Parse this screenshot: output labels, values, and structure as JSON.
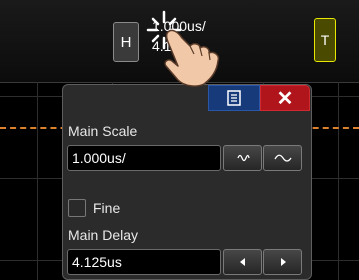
{
  "top": {
    "h_label": "H",
    "t_label": "T",
    "readout_line1": "1.000us/",
    "readout_line2": "4.1"
  },
  "panel": {
    "main_scale_label": "Main Scale",
    "main_scale_value": "1.000us/",
    "fine_label": "Fine",
    "fine_checked": false,
    "main_delay_label": "Main Delay",
    "main_delay_value": "4.125us",
    "close_symbol": "✕",
    "icons": [
      "list-icon",
      "close-icon",
      "fine-wave-icon",
      "coarse-wave-icon",
      "left-arrow-icon",
      "right-arrow-icon",
      "tap-gesture-icon"
    ]
  },
  "colors": {
    "trigger": "#d9822b",
    "list_button": "#173a7a",
    "close_button": "#b0151c",
    "t_button_border": "#e8e800"
  }
}
